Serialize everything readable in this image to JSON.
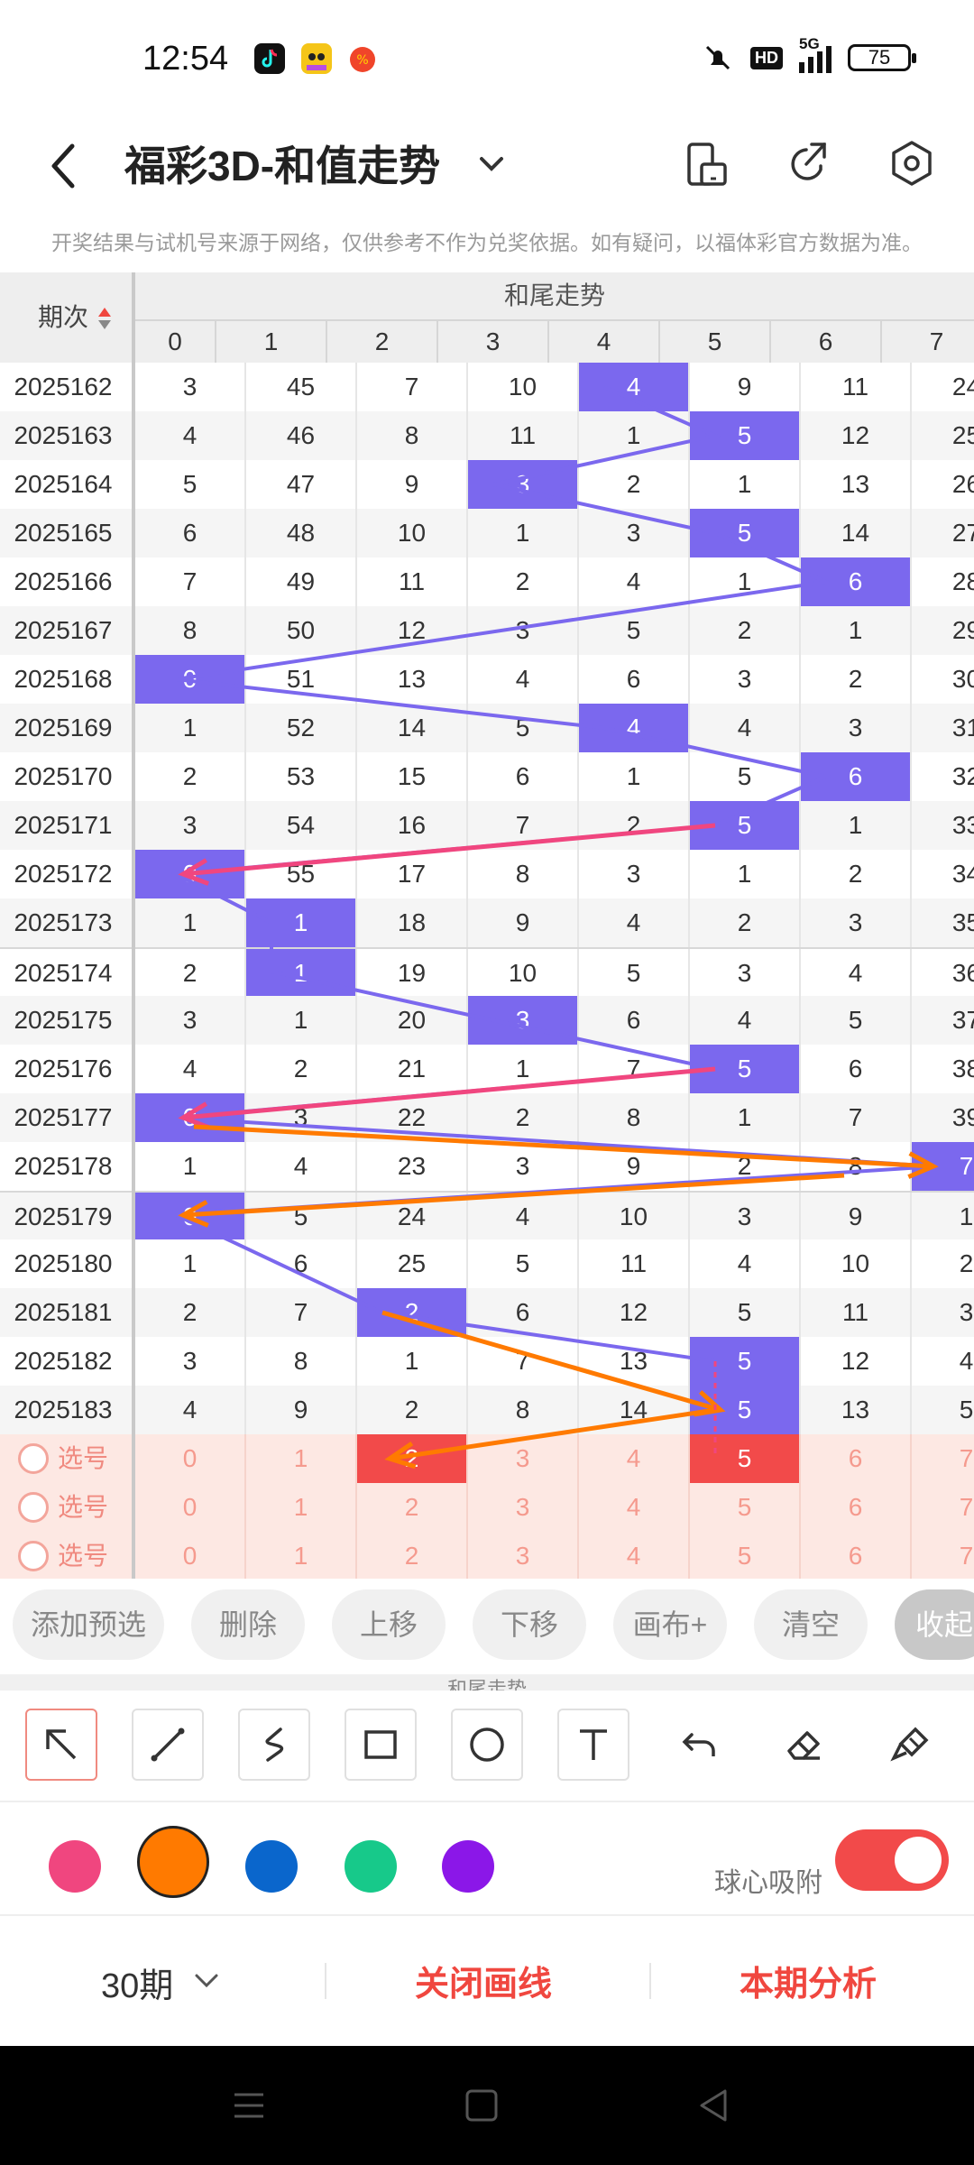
{
  "status_bar": {
    "time": "12:54",
    "network": "5G",
    "hd": "HD",
    "battery": "75",
    "icons": [
      "douyin-icon",
      "game-icon",
      "orange-app-icon",
      "mute-icon",
      "signal-icon",
      "battery-icon"
    ]
  },
  "header": {
    "title": "福彩3D-和值走势",
    "icons": [
      "back-icon",
      "chevron-down-icon",
      "phone-rotate-icon",
      "share-icon",
      "settings-icon"
    ]
  },
  "notice": "开奖结果与试机号来源于网络，仅供参考不作为兑奖依据。如有疑问，以福体彩官方数据为准。",
  "table": {
    "period_header": "期次",
    "group_header": "和尾走势",
    "columns": [
      "0",
      "1",
      "2",
      "3",
      "4",
      "5",
      "6",
      "7"
    ],
    "rows": [
      {
        "period": "2025162",
        "cells": [
          "3",
          "45",
          "7",
          "10",
          "4",
          "9",
          "11",
          "24"
        ],
        "hit": 4
      },
      {
        "period": "2025163",
        "cells": [
          "4",
          "46",
          "8",
          "11",
          "1",
          "5",
          "12",
          "25"
        ],
        "hit": 5
      },
      {
        "period": "2025164",
        "cells": [
          "5",
          "47",
          "9",
          "3",
          "2",
          "1",
          "13",
          "26"
        ],
        "hit": 3
      },
      {
        "period": "2025165",
        "cells": [
          "6",
          "48",
          "10",
          "1",
          "3",
          "5",
          "14",
          "27"
        ],
        "hit": 5
      },
      {
        "period": "2025166",
        "cells": [
          "7",
          "49",
          "11",
          "2",
          "4",
          "1",
          "6",
          "28"
        ],
        "hit": 6
      },
      {
        "period": "2025167",
        "cells": [
          "8",
          "50",
          "12",
          "3",
          "5",
          "2",
          "1",
          "29"
        ],
        "hit": -1
      },
      {
        "period": "2025168",
        "cells": [
          "0",
          "51",
          "13",
          "4",
          "6",
          "3",
          "2",
          "30"
        ],
        "hit": 0
      },
      {
        "period": "2025169",
        "cells": [
          "1",
          "52",
          "14",
          "5",
          "4",
          "4",
          "3",
          "31"
        ],
        "hit": 4
      },
      {
        "period": "2025170",
        "cells": [
          "2",
          "53",
          "15",
          "6",
          "1",
          "5",
          "6",
          "32"
        ],
        "hit": 6
      },
      {
        "period": "2025171",
        "cells": [
          "3",
          "54",
          "16",
          "7",
          "2",
          "5",
          "1",
          "33"
        ],
        "hit": 5
      },
      {
        "period": "2025172",
        "cells": [
          "0",
          "55",
          "17",
          "8",
          "3",
          "1",
          "2",
          "34"
        ],
        "hit": 0
      },
      {
        "period": "2025173",
        "cells": [
          "1",
          "1",
          "18",
          "9",
          "4",
          "2",
          "3",
          "35"
        ],
        "hit": 1
      },
      {
        "period": "2025174",
        "cells": [
          "2",
          "1",
          "19",
          "10",
          "5",
          "3",
          "4",
          "36"
        ],
        "hit": 1
      },
      {
        "period": "2025175",
        "cells": [
          "3",
          "1",
          "20",
          "3",
          "6",
          "4",
          "5",
          "37"
        ],
        "hit": 3
      },
      {
        "period": "2025176",
        "cells": [
          "4",
          "2",
          "21",
          "1",
          "7",
          "5",
          "6",
          "38"
        ],
        "hit": 5
      },
      {
        "period": "2025177",
        "cells": [
          "0",
          "3",
          "22",
          "2",
          "8",
          "1",
          "7",
          "39"
        ],
        "hit": 0
      },
      {
        "period": "2025178",
        "cells": [
          "1",
          "4",
          "23",
          "3",
          "9",
          "2",
          "8",
          "7"
        ],
        "hit": 7
      },
      {
        "period": "2025179",
        "cells": [
          "0",
          "5",
          "24",
          "4",
          "10",
          "3",
          "9",
          "1"
        ],
        "hit": 0
      },
      {
        "period": "2025180",
        "cells": [
          "1",
          "6",
          "25",
          "5",
          "11",
          "4",
          "10",
          "2"
        ],
        "hit": -1
      },
      {
        "period": "2025181",
        "cells": [
          "2",
          "7",
          "2",
          "6",
          "12",
          "5",
          "11",
          "3"
        ],
        "hit": 2
      },
      {
        "period": "2025182",
        "cells": [
          "3",
          "8",
          "1",
          "7",
          "13",
          "5",
          "12",
          "4"
        ],
        "hit": 5
      },
      {
        "period": "2025183",
        "cells": [
          "4",
          "9",
          "2",
          "8",
          "14",
          "5",
          "13",
          "5"
        ],
        "hit": 5
      }
    ],
    "select_rows": [
      {
        "label": "选号",
        "cells": [
          "0",
          "1",
          "2",
          "3",
          "4",
          "5",
          "6",
          "7"
        ],
        "hit": [
          2,
          5
        ]
      },
      {
        "label": "选号",
        "cells": [
          "0",
          "1",
          "2",
          "3",
          "4",
          "5",
          "6",
          "7"
        ],
        "hit": []
      },
      {
        "label": "选号",
        "cells": [
          "0",
          "1",
          "2",
          "3",
          "4",
          "5",
          "6",
          "7"
        ],
        "hit": []
      }
    ]
  },
  "actions": {
    "add_preselect": "添加预选",
    "delete": "删除",
    "move_up": "上移",
    "move_down": "下移",
    "canvas_plus": "画布+",
    "clear": "清空",
    "collapse": "收起"
  },
  "drawing_tools": [
    "arrow-tool-icon",
    "line-tool-icon",
    "freehand-tool-icon",
    "rectangle-tool-icon",
    "circle-tool-icon",
    "text-tool-icon",
    "undo-icon",
    "eraser-icon",
    "clear-brush-icon"
  ],
  "colors": {
    "options": [
      "#f0467f",
      "#ff7a00",
      "#0a66cc",
      "#17c98a",
      "#8b17e8"
    ],
    "selected": "#ff7a00",
    "hit_cell": "#7b68ee",
    "selected_cell": "#f24a4a"
  },
  "snap": {
    "label": "球心吸附",
    "enabled": true
  },
  "bottom": {
    "periods": "30期",
    "close_lines": "关闭画线",
    "analysis": "本期分析"
  },
  "system_nav": [
    "menu-icon",
    "home-icon",
    "back-nav-icon"
  ]
}
